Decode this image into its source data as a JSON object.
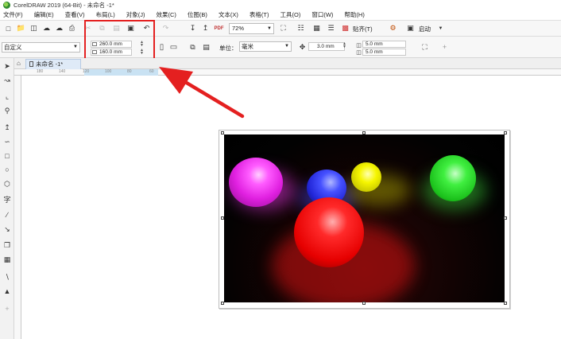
{
  "window": {
    "title": "CorelDRAW 2019 (64-Bit) - 未命名 -1*"
  },
  "menu": [
    "文件(F)",
    "编辑(E)",
    "查看(V)",
    "布局(L)",
    "对象(J)",
    "效果(C)",
    "位图(B)",
    "文本(X)",
    "表格(T)",
    "工具(O)",
    "窗口(W)",
    "帮助(H)"
  ],
  "toolbar": {
    "zoom": "72%",
    "snap_label": "贴齐(T)",
    "launch_label": "启动"
  },
  "properties": {
    "preset": "自定义",
    "width": "260.0 mm",
    "height": "160.0 mm",
    "unit_label": "单位：",
    "unit": "毫米",
    "nudge": "3.0 mm",
    "dup_x": "5.0 mm",
    "dup_y": "5.0 mm"
  },
  "document": {
    "tab_label": "未命名 -1*"
  },
  "ruler": {
    "ticks": [
      "180",
      "140",
      "120",
      "100",
      "80",
      "60",
      "40"
    ]
  },
  "colors": {
    "accent_red": "#e42020",
    "tab_blue": "#dfeaf7"
  },
  "photo": {
    "balls": [
      {
        "color": "magenta",
        "hex": "#ff40ff"
      },
      {
        "color": "blue",
        "hex": "#3340ff"
      },
      {
        "color": "yellow",
        "hex": "#f2f200"
      },
      {
        "color": "green",
        "hex": "#30e030"
      },
      {
        "color": "red",
        "hex": "#ff1a1a"
      }
    ]
  }
}
